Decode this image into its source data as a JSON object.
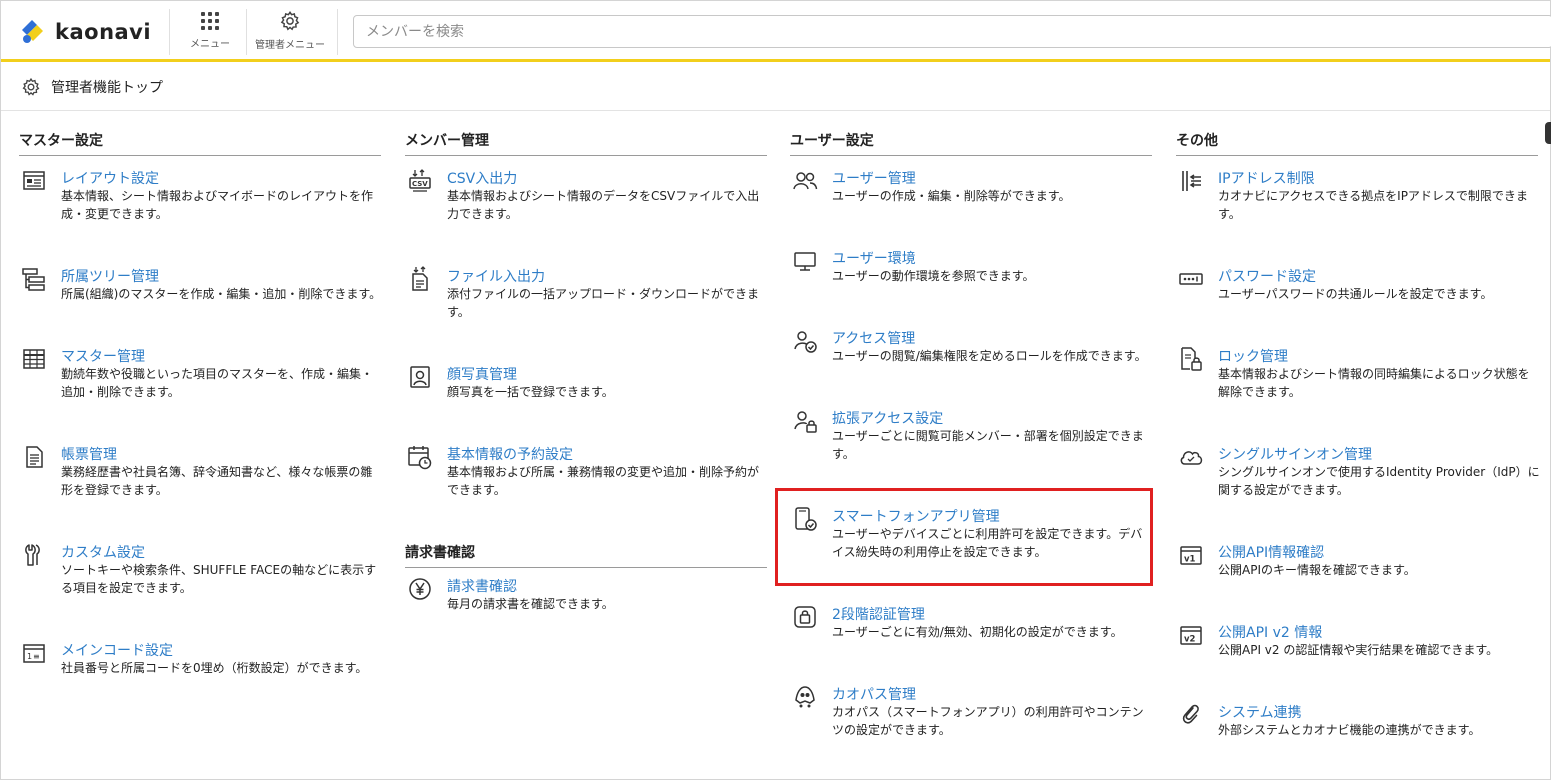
{
  "header": {
    "logo_text": "kaonavi",
    "menu_label": "メニュー",
    "admin_menu_label": "管理者メニュー",
    "search_placeholder": "メンバーを検索"
  },
  "page_title": "管理者機能トップ",
  "colors": {
    "link": "#2e7dc7",
    "accent_bar": "#f2cf1c",
    "highlight": "#e02020"
  },
  "columns": [
    {
      "title": "マスター設定",
      "items": [
        {
          "icon": "layout-icon",
          "label": "レイアウト設定",
          "desc": "基本情報、シート情報およびマイボードのレイアウトを作成・変更できます。"
        },
        {
          "icon": "tree-icon",
          "label": "所属ツリー管理",
          "desc": "所属(組織)のマスターを作成・編集・追加・削除できます。"
        },
        {
          "icon": "table-icon",
          "label": "マスター管理",
          "desc": "勤続年数や役職といった項目のマスターを、作成・編集・追加・削除できます。"
        },
        {
          "icon": "document-icon",
          "label": "帳票管理",
          "desc": "業務経歴書や社員名簿、辞令通知書など、様々な帳票の雛形を登録できます。"
        },
        {
          "icon": "wrench-icon",
          "label": "カスタム設定",
          "desc": "ソートキーや検索条件、SHUFFLE FACEの軸などに表示する項目を設定できます。"
        },
        {
          "icon": "code-icon",
          "label": "メインコード設定",
          "desc": "社員番号と所属コードを0埋め（桁数設定）ができます。"
        }
      ]
    },
    {
      "title": "メンバー管理",
      "items": [
        {
          "icon": "csv-icon",
          "label": "CSV入出力",
          "desc": "基本情報およびシート情報のデータをCSVファイルで入出力できます。"
        },
        {
          "icon": "file-transfer-icon",
          "label": "ファイル入出力",
          "desc": "添付ファイルの一括アップロード・ダウンロードができます。"
        },
        {
          "icon": "portrait-icon",
          "label": "顔写真管理",
          "desc": "顔写真を一括で登録できます。"
        },
        {
          "icon": "calendar-clock-icon",
          "label": "基本情報の予約設定",
          "desc": "基本情報および所属・兼務情報の変更や追加・削除予約ができます。"
        }
      ],
      "section2_title": "請求書確認",
      "section2_items": [
        {
          "icon": "yen-icon",
          "label": "請求書確認",
          "desc": "毎月の請求書を確認できます。"
        }
      ]
    },
    {
      "title": "ユーザー設定",
      "items": [
        {
          "icon": "users-icon",
          "label": "ユーザー管理",
          "desc": "ユーザーの作成・編集・削除等ができます。"
        },
        {
          "icon": "monitor-icon",
          "label": "ユーザー環境",
          "desc": "ユーザーの動作環境を参照できます。"
        },
        {
          "icon": "user-check-icon",
          "label": "アクセス管理",
          "desc": "ユーザーの閲覧/編集権限を定めるロールを作成できます。"
        },
        {
          "icon": "user-lock-icon",
          "label": "拡張アクセス設定",
          "desc": "ユーザーごとに閲覧可能メンバー・部署を個別設定できます。"
        },
        {
          "icon": "smartphone-check-icon",
          "label": "スマートフォンアプリ管理",
          "desc": "ユーザーやデバイスごとに利用許可を設定できます。デバイス紛失時の利用停止を設定できます。"
        },
        {
          "icon": "two-factor-icon",
          "label": "2段階認証管理",
          "desc": "ユーザーごとに有効/無効、初期化の設定ができます。"
        },
        {
          "icon": "mascot-icon",
          "label": "カオパス管理",
          "desc": "カオパス（スマートフォンアプリ）の利用許可やコンテンツの設定ができます。"
        }
      ]
    },
    {
      "title": "その他",
      "items": [
        {
          "icon": "ip-restrict-icon",
          "label": "IPアドレス制限",
          "desc": "カオナビにアクセスできる拠点をIPアドレスで制限できます。"
        },
        {
          "icon": "password-icon",
          "label": "パスワード設定",
          "desc": "ユーザーパスワードの共通ルールを設定できます。"
        },
        {
          "icon": "doc-lock-icon",
          "label": "ロック管理",
          "desc": "基本情報およびシート情報の同時編集によるロック状態を解除できます。"
        },
        {
          "icon": "cloud-icon",
          "label": "シングルサインオン管理",
          "desc": "シングルサインオンで使用するIdentity Provider（IdP）に関する設定ができます。"
        },
        {
          "icon": "api-v1-icon",
          "label": "公開API情報確認",
          "desc": "公開APIのキー情報を確認できます。"
        },
        {
          "icon": "api-v2-icon",
          "label": "公開API v2 情報",
          "desc": "公開API v2 の認証情報や実行結果を確認できます。"
        },
        {
          "icon": "link-icon",
          "label": "システム連携",
          "desc": "外部システムとカオナビ機能の連携ができます。"
        }
      ]
    }
  ]
}
